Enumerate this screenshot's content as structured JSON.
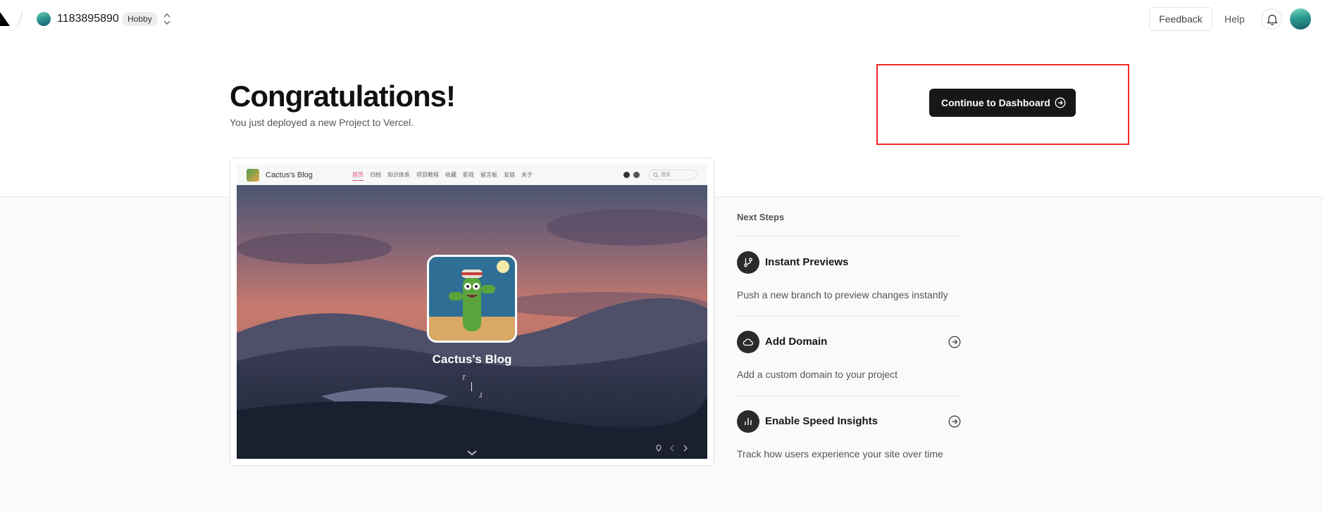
{
  "header": {
    "team_name": "1183895890",
    "plan_badge": "Hobby",
    "feedback_label": "Feedback",
    "help_label": "Help"
  },
  "hero": {
    "title": "Congratulations!",
    "subtitle": "You just deployed a new Project to Vercel.",
    "continue_label": "Continue to Dashboard"
  },
  "preview": {
    "site_name": "Cactus's Blog",
    "menu": [
      "首页",
      "归档",
      "知识体系",
      "项目教程",
      "收藏",
      "影视",
      "留言板",
      "友链",
      "关于"
    ],
    "search_placeholder": "搜索",
    "hero_title": "Cactus's Blog",
    "quote_open": "『",
    "quote_close": "』"
  },
  "next_steps": {
    "title": "Next Steps",
    "items": [
      {
        "title": "Instant Previews",
        "description": "Push a new branch to preview changes instantly",
        "icon": "git-branch-icon"
      },
      {
        "title": "Add Domain",
        "description": "Add a custom domain to your project",
        "icon": "cloud-icon"
      },
      {
        "title": "Enable Speed Insights",
        "description": "Track how users experience your site over time",
        "icon": "bar-chart-icon"
      }
    ]
  },
  "colors": {
    "accent_dark": "#171717",
    "highlight_red": "#ee2a2a",
    "page_bg": "#fafafa"
  }
}
